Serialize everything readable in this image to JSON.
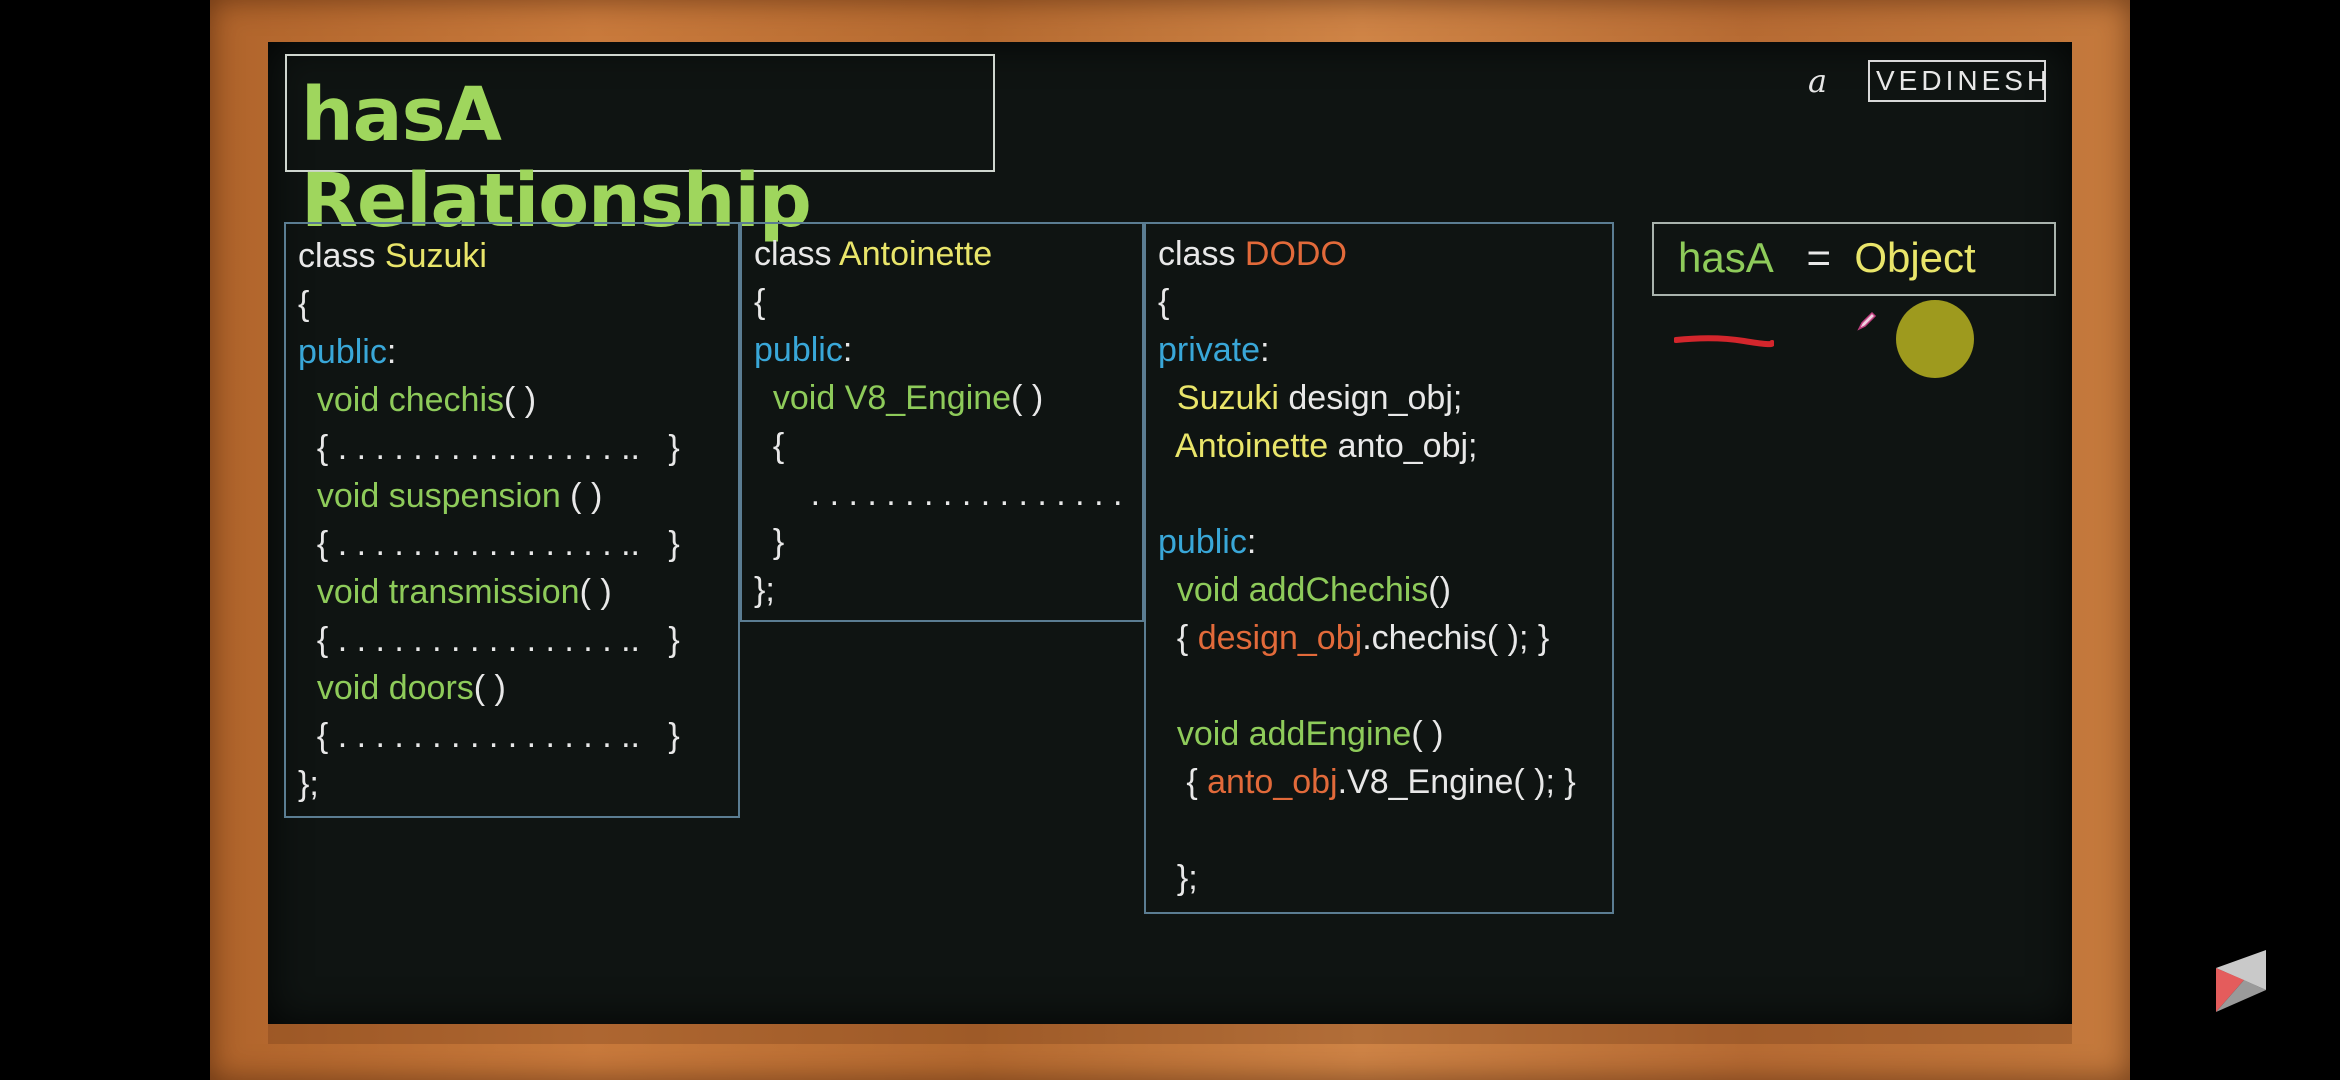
{
  "title": "hasA Relationship",
  "logo": {
    "script": "a",
    "text": "VEDINESH"
  },
  "suzuki": {
    "lines": [
      [
        [
          "class ",
          "w"
        ],
        [
          "Suzuki",
          "y"
        ]
      ],
      [
        [
          "{",
          "w"
        ]
      ],
      [
        [
          "public",
          "b"
        ],
        [
          ":",
          "w"
        ]
      ],
      [
        [
          "  void ",
          "g"
        ],
        [
          "chechis",
          "g"
        ],
        [
          "( )",
          "w"
        ]
      ],
      [
        [
          "  { . . . . . . . . . . . . . . . ..   }",
          "w"
        ]
      ],
      [
        [
          "  void ",
          "g"
        ],
        [
          "suspension",
          "g"
        ],
        [
          " ( )",
          "w"
        ]
      ],
      [
        [
          "  { . . . . . . . . . . . . . . . ..   }",
          "w"
        ]
      ],
      [
        [
          "  void ",
          "g"
        ],
        [
          "transmission",
          "g"
        ],
        [
          "( )",
          "w"
        ]
      ],
      [
        [
          "  { . . . . . . . . . . . . . . . ..   }",
          "w"
        ]
      ],
      [
        [
          "  void ",
          "g"
        ],
        [
          "doors",
          "g"
        ],
        [
          "( )",
          "w"
        ]
      ],
      [
        [
          "  { . . . . . . . . . . . . . . . ..   }",
          "w"
        ]
      ],
      [
        [
          "};",
          "w"
        ]
      ]
    ]
  },
  "antoinette": {
    "lines": [
      [
        [
          "class ",
          "w"
        ],
        [
          "Antoinette",
          "y"
        ]
      ],
      [
        [
          "{",
          "w"
        ]
      ],
      [
        [
          "public",
          "b"
        ],
        [
          ":",
          "w"
        ]
      ],
      [
        [
          "  void ",
          "g"
        ],
        [
          "V8_Engine",
          "g"
        ],
        [
          "( )",
          "w"
        ]
      ],
      [
        [
          "  {",
          "w"
        ]
      ],
      [
        [
          "      . . . . . . . . . . . . . . . . .",
          "w"
        ]
      ],
      [
        [
          "  }",
          "w"
        ]
      ],
      [
        [
          "};",
          "w"
        ]
      ]
    ]
  },
  "dodo": {
    "lines": [
      [
        [
          "class ",
          "w"
        ],
        [
          "DODO",
          "o"
        ]
      ],
      [
        [
          "{",
          "w"
        ]
      ],
      [
        [
          "private",
          "b"
        ],
        [
          ":",
          "w"
        ]
      ],
      [
        [
          "  Suzuki",
          "y"
        ],
        [
          " design_obj;",
          "w"
        ]
      ],
      [
        [
          "  Antoinette",
          "y"
        ],
        [
          " anto_obj;",
          "w"
        ]
      ],
      [
        [
          "",
          "w"
        ]
      ],
      [
        [
          "public",
          "b"
        ],
        [
          ":",
          "w"
        ]
      ],
      [
        [
          "  void ",
          "g"
        ],
        [
          "addChechis",
          "g"
        ],
        [
          "()",
          "w"
        ]
      ],
      [
        [
          "  { ",
          "w"
        ],
        [
          "design_obj",
          "o"
        ],
        [
          ".chechis( ); }",
          "w"
        ]
      ],
      [
        [
          "",
          "w"
        ]
      ],
      [
        [
          "  void ",
          "g"
        ],
        [
          "addEngine",
          "g"
        ],
        [
          "( )",
          "w"
        ]
      ],
      [
        [
          "   { ",
          "w"
        ],
        [
          "anto_obj",
          "o"
        ],
        [
          ".V8_Engine( ); }",
          "w"
        ]
      ],
      [
        [
          "",
          "w"
        ]
      ],
      [
        [
          "  };",
          "w"
        ]
      ]
    ]
  },
  "hasa": {
    "left": "hasA",
    "eq": "=",
    "right": "Object"
  },
  "colors": {
    "green": "#8ecb5a",
    "yellow": "#e9e56a",
    "blue": "#39a7d8",
    "orange": "#e26a3a",
    "title_green": "#9fd65d",
    "board": "#0f1412",
    "frame": "#c27638"
  }
}
